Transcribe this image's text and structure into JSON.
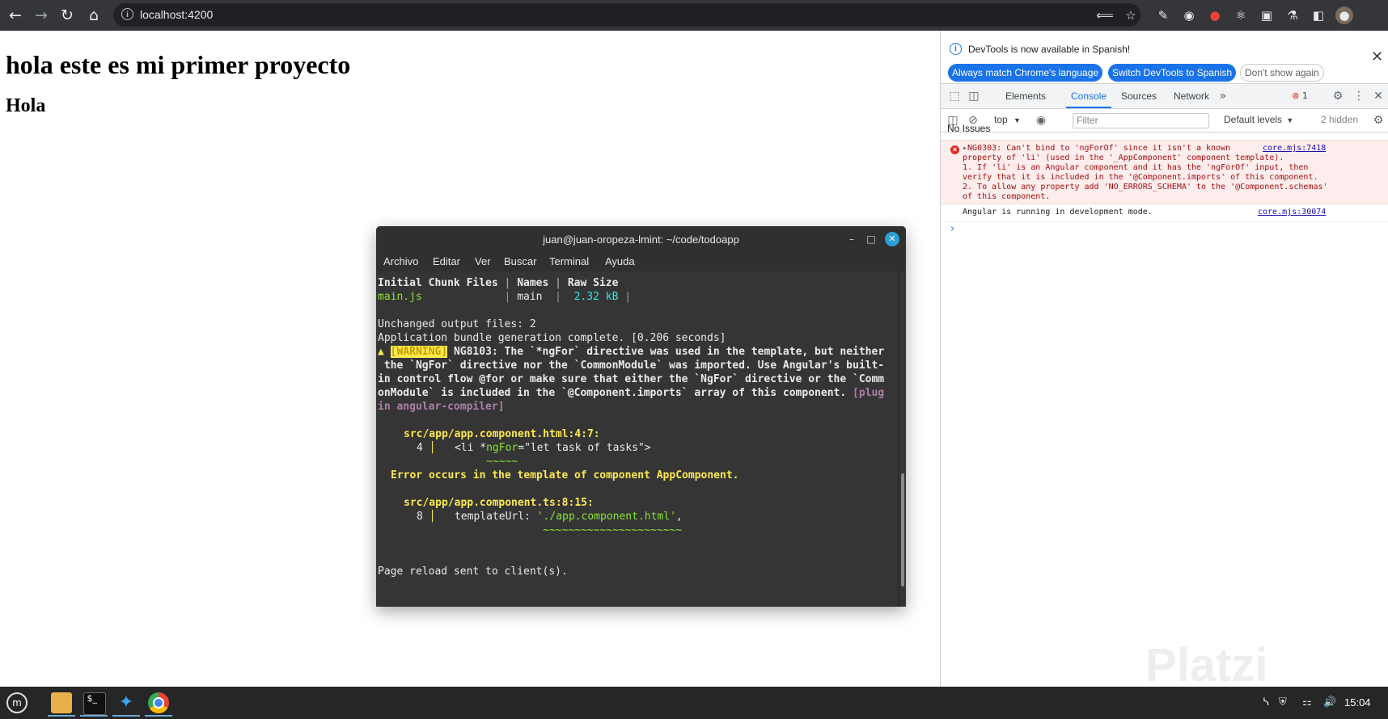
{
  "browser": {
    "url": "localhost:4200",
    "icons": [
      "back-icon",
      "forward-icon",
      "reload-icon",
      "home-icon",
      "info-icon",
      "share-icon",
      "star-icon",
      "pen-icon",
      "camera-icon",
      "red-extension-icon",
      "react-icon",
      "puzzle-icon",
      "flask-icon",
      "sidebar-icon",
      "avatar"
    ]
  },
  "page": {
    "heading": "hola este es mi primer proyecto",
    "subheading": "Hola"
  },
  "devtools": {
    "info_message": "DevTools is now available in Spanish!",
    "btn_match": "Always match Chrome's language",
    "btn_switch": "Switch DevTools to Spanish",
    "btn_dont_show": "Don't show again",
    "tabs": [
      "Elements",
      "Console",
      "Sources",
      "Network"
    ],
    "active_tab": "Console",
    "error_count": "1",
    "context": "top",
    "filter_placeholder": "Filter",
    "levels": "Default levels",
    "hidden": "2 hidden",
    "no_issues": "No Issues",
    "error_message": "NG0303: Can't bind to 'ngForOf' since it isn't a known\nproperty of 'li' (used in the '_AppComponent' component template).\n1. If 'li' is an Angular component and it has the 'ngForOf' input, then\nverify that it is included in the '@Component.imports' of this component.\n2. To allow any property add 'NO_ERRORS_SCHEMA' to the '@Component.schemas'\nof this component.",
    "error_source": "core.mjs:7418",
    "log_message": "Angular is running in development mode.",
    "log_source": "core.mjs:30074",
    "colors": {
      "accent": "#1a73e8",
      "error_bg": "#fdeded",
      "error_text": "#a50e0e"
    }
  },
  "terminal": {
    "title": "juan@juan-oropeza-lmint: ~/code/todoapp",
    "menu": [
      "Archivo",
      "Editar",
      "Ver",
      "Buscar",
      "Terminal",
      "Ayuda"
    ],
    "header_cols": [
      "Initial Chunk Files",
      "Names",
      "Raw Size"
    ],
    "file": "main.js",
    "name": "main",
    "size": "2.32 kB",
    "unchanged": "Unchanged output files: 2",
    "bundle": "Application bundle generation complete. [0.206 seconds]",
    "warn_label": "WARNING",
    "warn_line1": "NG8103: The `*ngFor` directive was used in the template, but neither",
    "warn_line2": " the `NgFor` directive nor the `CommonModule` was imported. Use Angular's built-",
    "warn_line3": "in control flow @for or make sure that either the `NgFor` directive or the `Comm",
    "warn_line4a": "onModule` is included in the `@Component.imports` array of this component. ",
    "warn_line4b": "[plug",
    "warn_line5": "in angular-compiler]",
    "loc1": "src/app/app.component.html:4:7:",
    "code1_num": "4",
    "code1_a": "<li *",
    "code1_b": "ngFor",
    "code1_c": "=\"let task of tasks\">",
    "underline1": "~~~~~",
    "error_ctx": "Error occurs in the template of component AppComponent.",
    "loc2": "src/app/app.component.ts:8:15:",
    "code2_num": "8",
    "code2_a": "templateUrl: ",
    "code2_b": "'./app.component.html'",
    "code2_c": ",",
    "underline2": "~~~~~~~~~~~~~~~~~~~~~~",
    "reload": "Page reload sent to client(s).",
    "colors": {
      "green": "#8ae234",
      "cyan": "#34e2e2",
      "yellow": "#fce94f"
    }
  },
  "taskbar": {
    "apps": [
      "mint-menu-icon",
      "files-icon",
      "terminal-icon",
      "vscode-icon",
      "chrome-icon"
    ],
    "clock": "15:04"
  },
  "watermark": "Platzi"
}
